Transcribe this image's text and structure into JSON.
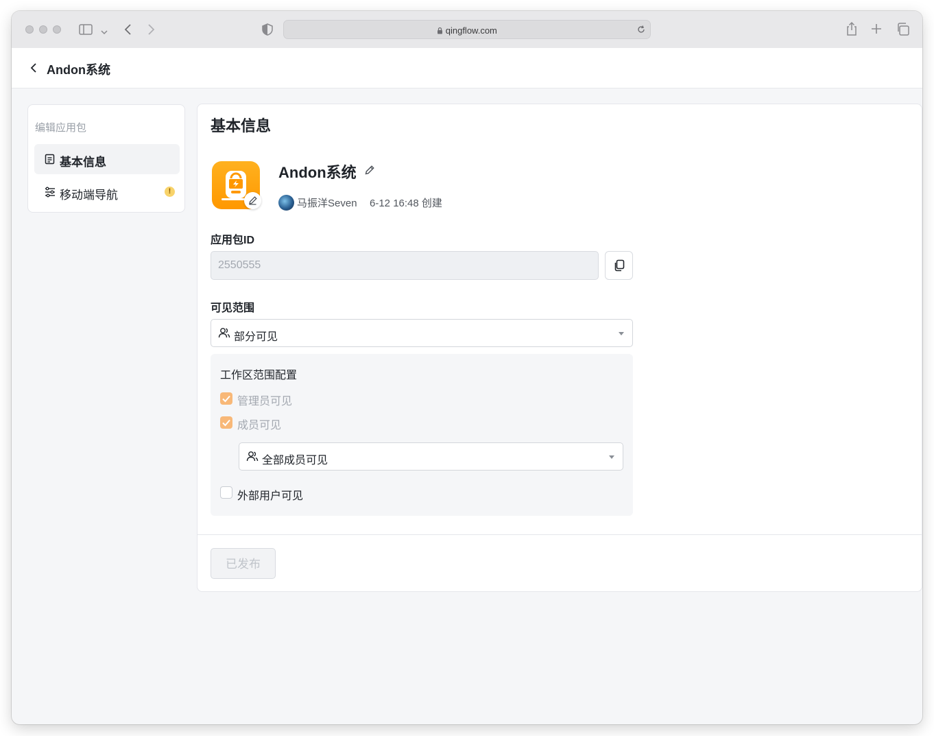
{
  "browser": {
    "url": "qingflow.com"
  },
  "header": {
    "back_title": "Andon系统"
  },
  "sidebar": {
    "section_label": "编辑应用包",
    "items": [
      {
        "label": "基本信息",
        "icon": "document-icon",
        "active": true
      },
      {
        "label": "移动端导航",
        "icon": "sliders-icon",
        "warning": "!"
      }
    ]
  },
  "main": {
    "title": "基本信息",
    "app": {
      "name": "Andon系统",
      "creator": "马振洋Seven",
      "created_at": "6-12 16:48 创建",
      "icon_color": "#ff9f0a"
    },
    "package_id": {
      "label": "应用包ID",
      "value": "2550555"
    },
    "visibility": {
      "label": "可见范围",
      "selected": "部分可见"
    },
    "workspace_config": {
      "title": "工作区范围配置",
      "admin_visible": {
        "label": "管理员可见",
        "checked": true
      },
      "member_visible": {
        "label": "成员可见",
        "checked": true
      },
      "member_scope": "全部成员可见",
      "external_visible": {
        "label": "外部用户可见",
        "checked": false
      }
    },
    "publish_button": "已发布"
  },
  "colors": {
    "accent_orange": "#ff9f0a",
    "checkbox_checked": "#f8b878",
    "warning_badge": "#f8d36a"
  }
}
